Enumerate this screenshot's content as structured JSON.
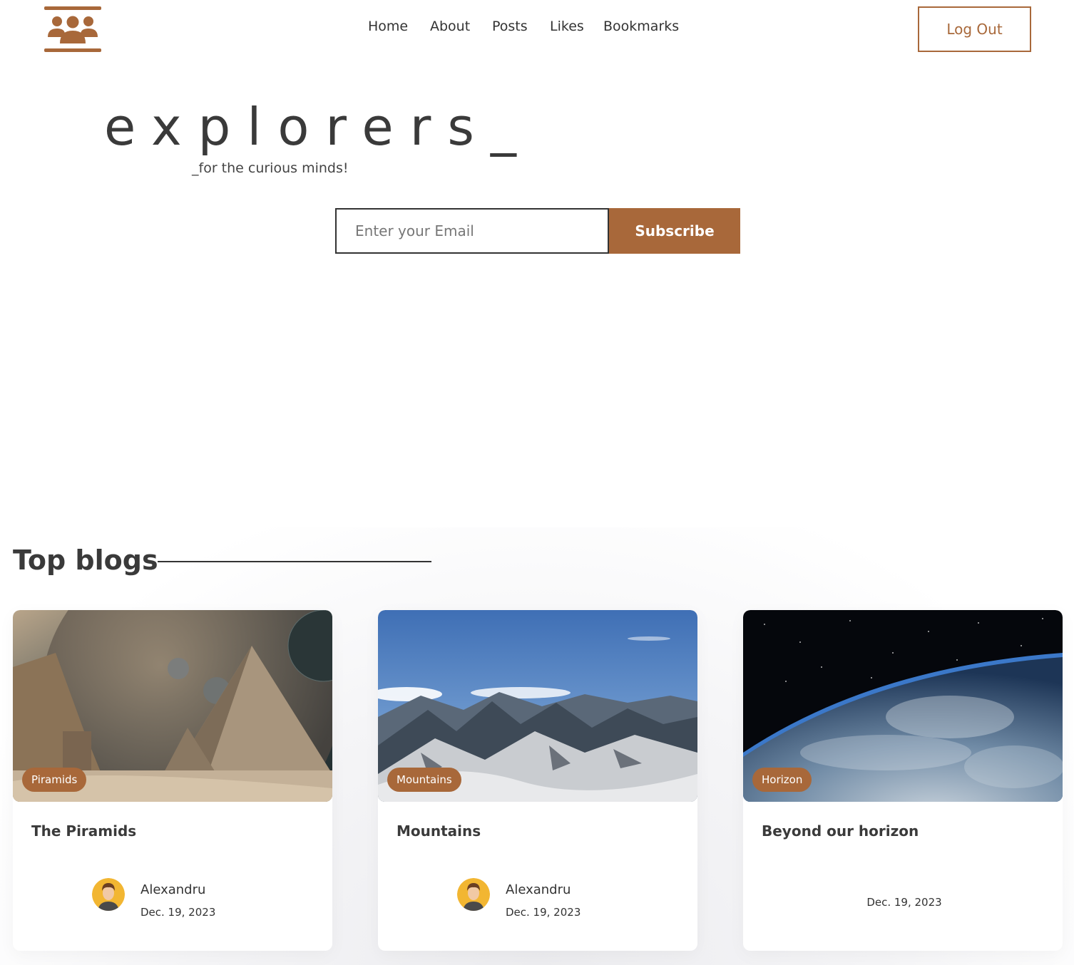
{
  "header": {
    "nav": [
      {
        "label": "Home"
      },
      {
        "label": "About"
      },
      {
        "label": "Posts"
      },
      {
        "label": "Likes"
      },
      {
        "label": "Bookmarks"
      }
    ],
    "logout_label": "Log Out",
    "logo_icon": "community-group-icon"
  },
  "hero": {
    "brand": "explorers_",
    "tagline": "_for the curious minds!",
    "email_placeholder": "Enter your Email",
    "subscribe_label": "Subscribe"
  },
  "top_blogs": {
    "title": "Top blogs",
    "cards": [
      {
        "tag": "Piramids",
        "title": "The Piramids",
        "author": "Alexandru",
        "date": "Dec. 19, 2023"
      },
      {
        "tag": "Mountains",
        "title": "Mountains",
        "author": "Alexandru",
        "date": "Dec. 19, 2023"
      },
      {
        "tag": "Horizon",
        "title": "Beyond our horizon",
        "author": "",
        "date": "Dec. 19, 2023"
      }
    ]
  },
  "colors": {
    "accent": "#a8683a",
    "text": "#3a3a3a"
  }
}
